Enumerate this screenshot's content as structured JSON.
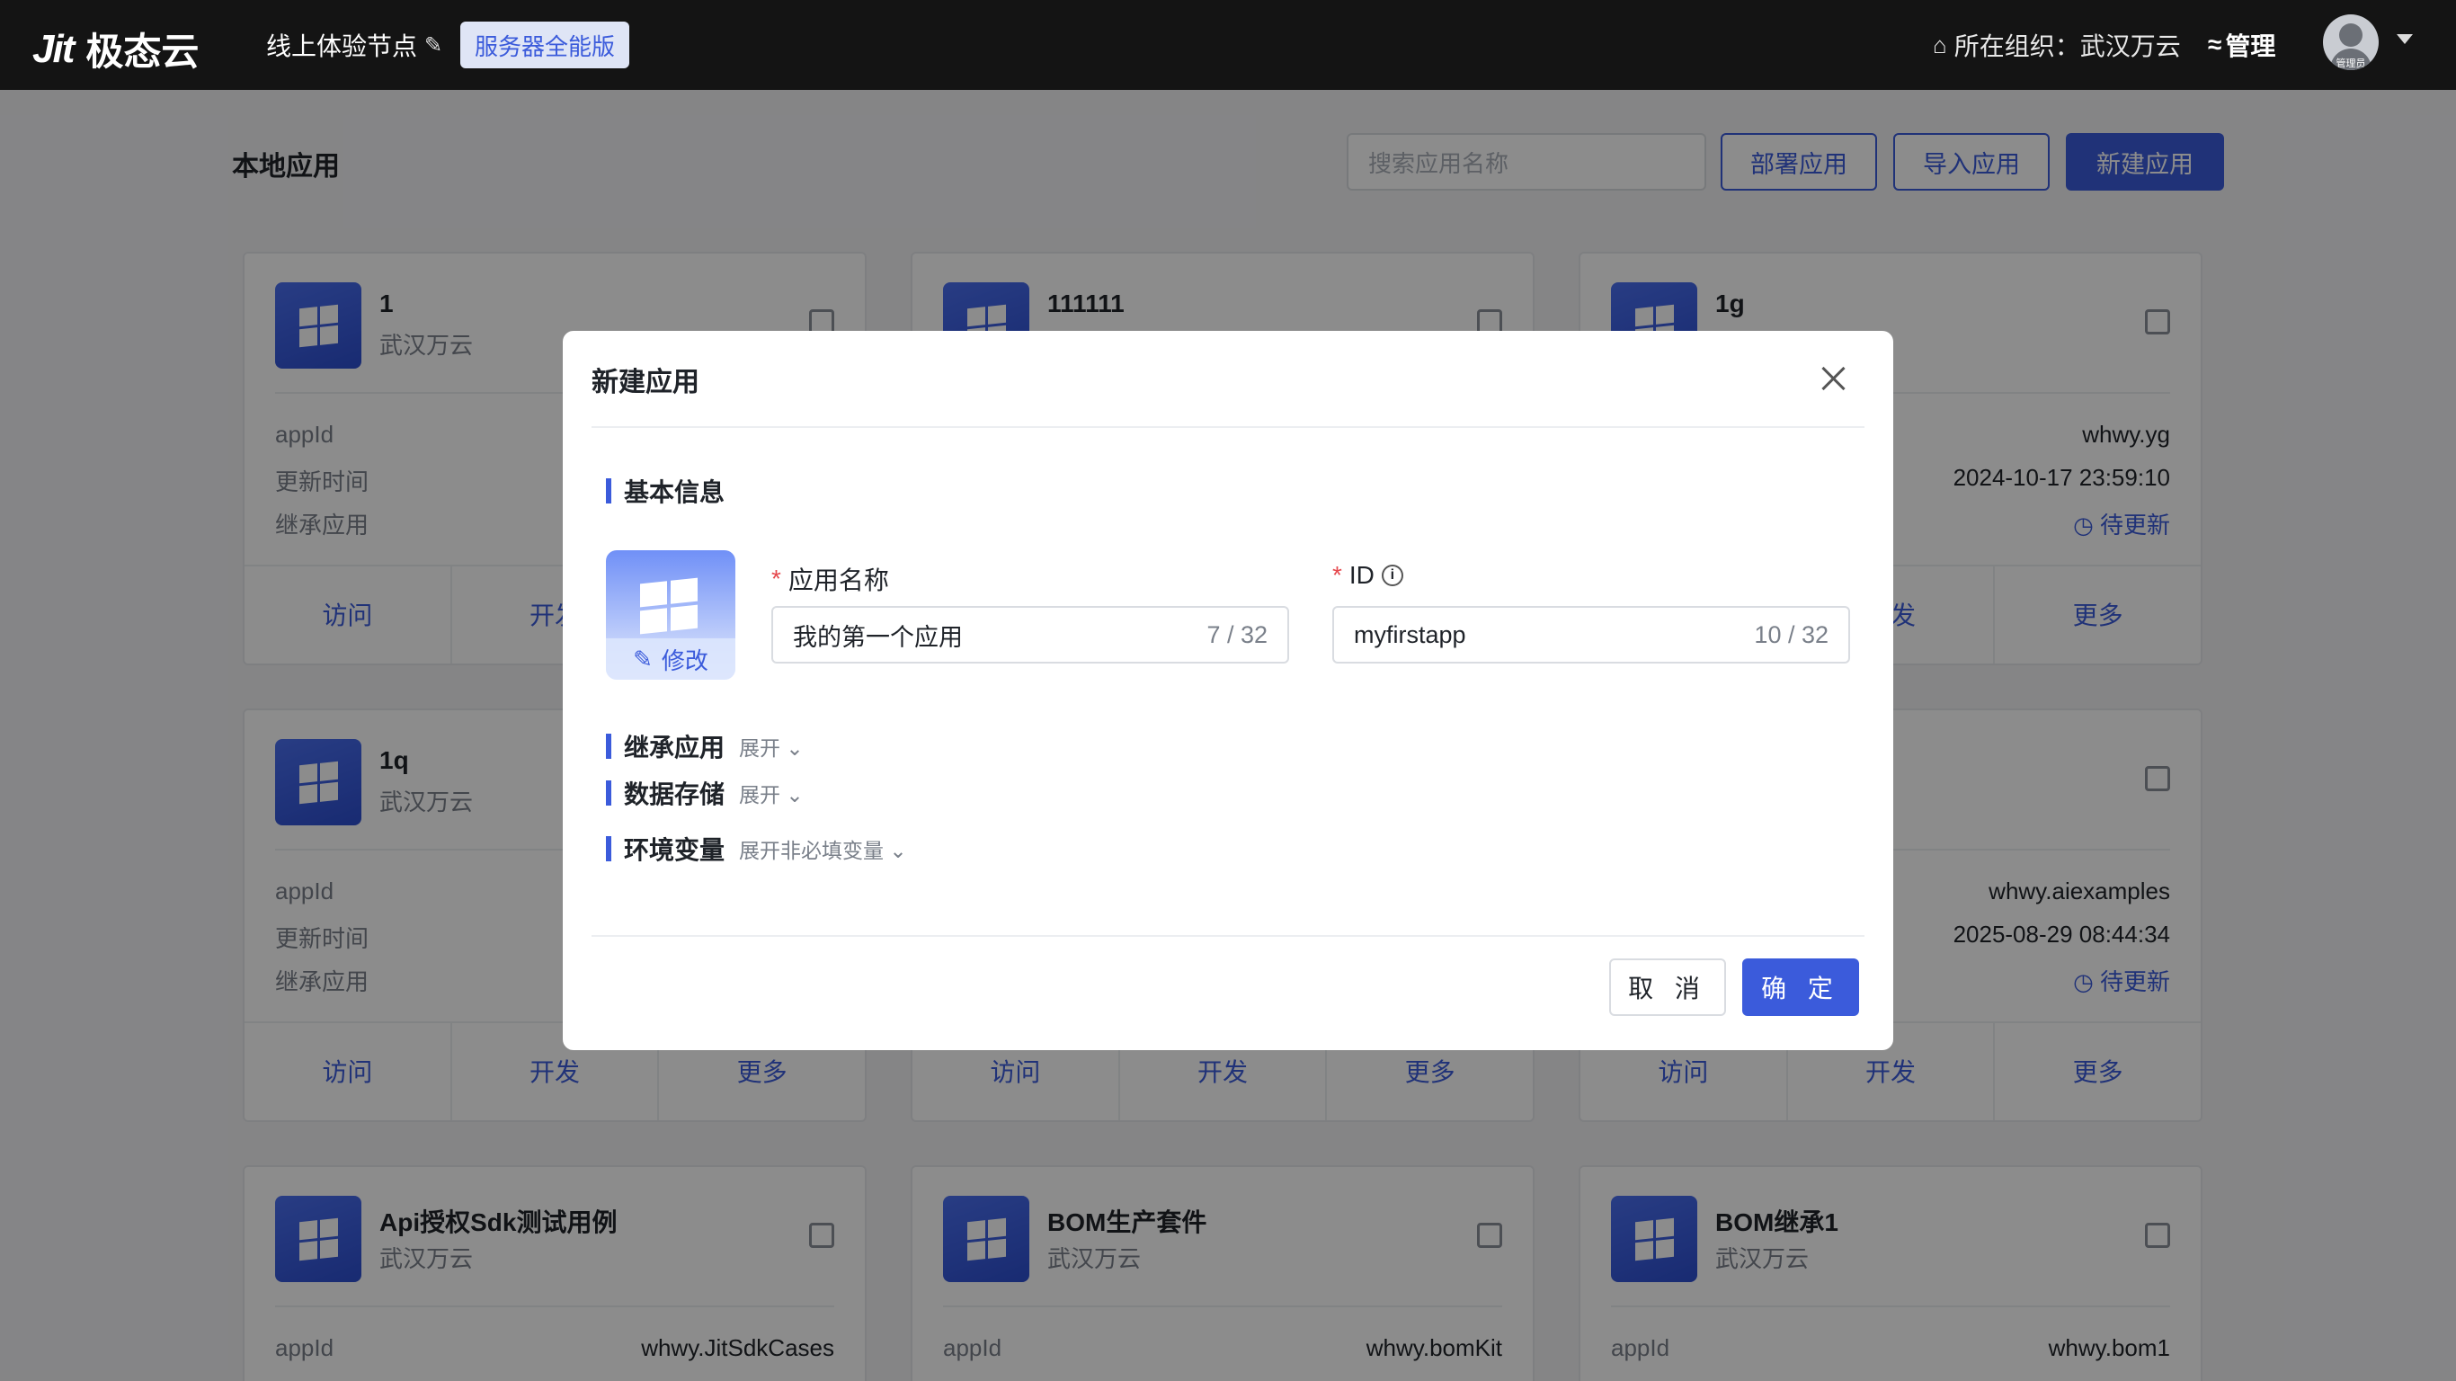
{
  "header": {
    "logo_mark": "Jit",
    "logo_name": "极态云",
    "node_label": "线上体验节点",
    "edition_badge": "服务器全能版",
    "org_label": "所在组织：武汉万云",
    "manage_label": "管理",
    "avatar_tag": "管理员"
  },
  "page": {
    "title": "本地应用",
    "search_placeholder": "搜索应用名称",
    "deploy_button": "部署应用",
    "import_button": "导入应用",
    "new_button": "新建应用"
  },
  "card_labels": {
    "appid": "appId",
    "updated": "更新时间",
    "inherit": "继承应用",
    "visit": "访问",
    "develop": "开发",
    "more": "更多"
  },
  "cards": [
    {
      "title": "1",
      "org": "武汉万云",
      "appid": "",
      "updated": "",
      "inherit": ""
    },
    {
      "title": "111111",
      "org": "",
      "appid": "",
      "updated": "",
      "inherit": ""
    },
    {
      "title": "1g",
      "org": "",
      "appid": "whwy.yg",
      "updated": "2024-10-17 23:59:10",
      "inherit": "待更新"
    },
    {
      "title": "1q",
      "org": "武汉万云",
      "appid": "",
      "updated": "",
      "inherit": ""
    },
    {
      "title": "",
      "org": "",
      "appid": "",
      "updated": "",
      "inherit": ""
    },
    {
      "title": "",
      "org": "",
      "appid": "whwy.aiexamples",
      "updated": "2025-08-29 08:44:34",
      "inherit": "待更新"
    },
    {
      "title": "Api授权Sdk测试用例",
      "org": "武汉万云",
      "appid": "whwy.JitSdkCases"
    },
    {
      "title": "BOM生产套件",
      "org": "武汉万云",
      "appid": "whwy.bomKit"
    },
    {
      "title": "BOM继承1",
      "org": "武汉万云",
      "appid": "whwy.bom1"
    }
  ],
  "modal": {
    "title": "新建应用",
    "section_basic": "基本信息",
    "icon_edit_label": "修改",
    "name_label": "应用名称",
    "name_value": "我的第一个应用",
    "name_count": "7 / 32",
    "id_label": "ID",
    "id_value": "myfirstapp",
    "id_count": "10 / 32",
    "section_inherit": "继承应用",
    "inherit_expand": "展开",
    "section_storage": "数据存储",
    "storage_expand": "展开",
    "section_env": "环境变量",
    "env_expand": "展开非必填变量",
    "cancel_button": "取 消",
    "confirm_button": "确 定"
  },
  "icons": {
    "edit": "pencil-icon",
    "home": "building-icon",
    "manage": "settings-icon",
    "copy": "copy-icon",
    "close": "close-icon",
    "info": "info-icon",
    "clock": "clock-icon"
  },
  "colors": {
    "accent": "#3b5bdb",
    "topbar": "#141414",
    "required": "#e5484d"
  }
}
